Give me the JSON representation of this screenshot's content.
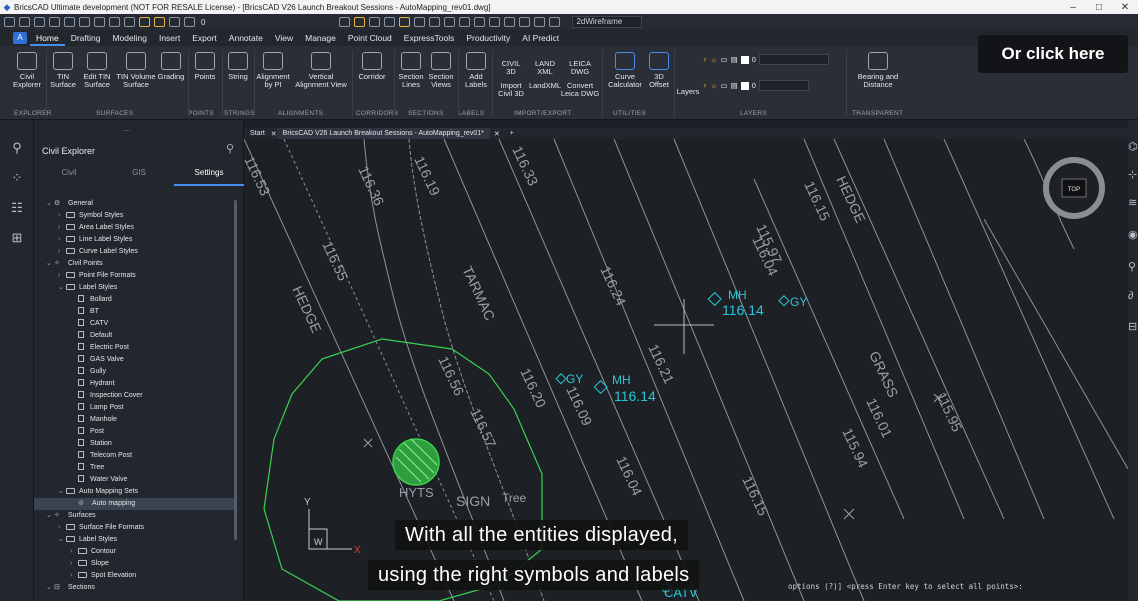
{
  "window": {
    "title": "BricsCAD Ultimate development (NOT FOR RESALE License) - [BricsCAD V26 Launch Breakout Sessions - AutoMapping_rev01.dwg]",
    "minimize": "–",
    "maximize": "□",
    "close": "✕"
  },
  "qat": {
    "layer_value": "0",
    "visual_style": "2dWireframe"
  },
  "menu": {
    "tabs": [
      "Home",
      "Drafting",
      "Modeling",
      "Insert",
      "Export",
      "Annotate",
      "View",
      "Manage",
      "Point Cloud",
      "ExpressTools",
      "Productivity",
      "AI Predict"
    ],
    "active": "Home"
  },
  "ribbon": {
    "buttons": {
      "civil_explorer": "Civil Explorer",
      "tin_surface": "TIN Surface",
      "edit_tin_surface": "Edit TIN Surface",
      "tin_volume_surface": "TIN Volume Surface",
      "grading": "Grading",
      "points": "Points",
      "string": "String",
      "alignment_by_pi": "Alignment by PI",
      "vertical_alignment_view": "Vertical Alignment View",
      "corridor": "Corridor",
      "section_lines": "Section Lines",
      "section_views": "Section Views",
      "add_labels": "Add Labels",
      "import_civil3d": "Import Civil 3D",
      "landxml": "LandXML",
      "convert_leica": "Convert Leica DWG",
      "curve_calculator": "Curve Calculator",
      "offset_3d": "3D Offset",
      "layers": "Layers",
      "bearing_distance": "Bearing and Distance"
    },
    "small_labels": {
      "civil": "CIVIL",
      "civil_3d": "3D",
      "land": "LAND",
      "xml": "XML",
      "leica": "LEICA",
      "dwg": "DWG",
      "threed": "3D"
    },
    "layer_value_1": "0",
    "layer_value_2": "0",
    "groups": [
      "EXPLORER",
      "SURFACES",
      "POINTS",
      "STRINGS",
      "ALIGNMENTS",
      "CORRIDORS",
      "SECTIONS",
      "LABELS",
      "IMPORT/EXPORT",
      "UTILITIES",
      "LAYERS",
      "TRANSPARENT"
    ]
  },
  "overlay": {
    "click_here": "Or click here"
  },
  "panel": {
    "title": "Civil Explorer",
    "dots": "....",
    "tabs": [
      "Civil",
      "GIS",
      "Settings"
    ],
    "active_tab": "Settings",
    "tree": [
      {
        "label": "General",
        "level": 0,
        "arrow": "v",
        "icon": "gear"
      },
      {
        "label": "Symbol Styles",
        "level": 1,
        "arrow": ">",
        "icon": "folder"
      },
      {
        "label": "Area Label Styles",
        "level": 1,
        "arrow": ">",
        "icon": "folder"
      },
      {
        "label": "Line Label Styles",
        "level": 1,
        "arrow": ">",
        "icon": "folder"
      },
      {
        "label": "Curve Label Styles",
        "level": 1,
        "arrow": ">",
        "icon": "folder"
      },
      {
        "label": "Civil Points",
        "level": 0,
        "arrow": "v",
        "icon": "point"
      },
      {
        "label": "Point File Formats",
        "level": 1,
        "arrow": ">",
        "icon": "folder"
      },
      {
        "label": "Label Styles",
        "level": 1,
        "arrow": "v",
        "icon": "folder"
      },
      {
        "label": "Bollard",
        "level": 2,
        "arrow": "",
        "icon": "doc"
      },
      {
        "label": "BT",
        "level": 2,
        "arrow": "",
        "icon": "doc"
      },
      {
        "label": "CATV",
        "level": 2,
        "arrow": "",
        "icon": "doc"
      },
      {
        "label": "Default",
        "level": 2,
        "arrow": "",
        "icon": "doc"
      },
      {
        "label": "Electric Post",
        "level": 2,
        "arrow": "",
        "icon": "doc"
      },
      {
        "label": "GAS Valve",
        "level": 2,
        "arrow": "",
        "icon": "doc"
      },
      {
        "label": "Gully",
        "level": 2,
        "arrow": "",
        "icon": "doc"
      },
      {
        "label": "Hydrant",
        "level": 2,
        "arrow": "",
        "icon": "doc"
      },
      {
        "label": "Inspection Cover",
        "level": 2,
        "arrow": "",
        "icon": "doc"
      },
      {
        "label": "Lamp Post",
        "level": 2,
        "arrow": "",
        "icon": "doc"
      },
      {
        "label": "Manhole",
        "level": 2,
        "arrow": "",
        "icon": "doc"
      },
      {
        "label": "Post",
        "level": 2,
        "arrow": "",
        "icon": "doc"
      },
      {
        "label": "Station",
        "level": 2,
        "arrow": "",
        "icon": "doc"
      },
      {
        "label": "Telecom Post",
        "level": 2,
        "arrow": "",
        "icon": "doc"
      },
      {
        "label": "Tree",
        "level": 2,
        "arrow": "",
        "icon": "doc"
      },
      {
        "label": "Water Valve",
        "level": 2,
        "arrow": "",
        "icon": "doc"
      },
      {
        "label": "Auto Mapping Sets",
        "level": 1,
        "arrow": "v",
        "icon": "folder"
      },
      {
        "label": "Auto mapping",
        "level": 2,
        "arrow": "",
        "icon": "check",
        "selected": true
      },
      {
        "label": "Surfaces",
        "level": 0,
        "arrow": "v",
        "icon": "point"
      },
      {
        "label": "Surface File Formats",
        "level": 1,
        "arrow": ">",
        "icon": "folder"
      },
      {
        "label": "Label Styles",
        "level": 1,
        "arrow": "v",
        "icon": "folder"
      },
      {
        "label": "Contour",
        "level": 2,
        "arrow": ">",
        "icon": "folder"
      },
      {
        "label": "Slope",
        "level": 2,
        "arrow": ">",
        "icon": "folder"
      },
      {
        "label": "Spot Elevation",
        "level": 2,
        "arrow": ">",
        "icon": "folder"
      },
      {
        "label": "Sections",
        "level": 0,
        "arrow": "v",
        "icon": "sections"
      }
    ]
  },
  "doc_tabs": {
    "start": "Start",
    "close": "✕",
    "active": "BricsCAD V26 Launch Breakout Sessions - AutoMapping_rev01*",
    "add": "+"
  },
  "viewport": {
    "viewcube": "TOP",
    "ucs_y": "Y",
    "ucs_x": "X",
    "ucs_w": "W",
    "labels": {
      "hedge_left": "HEDGE",
      "hedge_right": "HEDGE",
      "tarmac": "TARMAC",
      "grass": "GRASS",
      "sign": "SIGN",
      "tree": "Tree",
      "hyts": "HYTS",
      "catv": "CATV",
      "mh_1": "MH",
      "mh_1_elev": "116.14",
      "gy_1": "GY",
      "gy_2": "GY",
      "mh_2": "MH",
      "mh_2_elev": "116.14"
    },
    "spot_levels": [
      "116.19",
      "116.33",
      "116.36",
      "116.55",
      "116.56",
      "116.57",
      "116.24",
      "116.20",
      "116.09",
      "116.21",
      "116.04",
      "115.97",
      "116.04",
      "116.15",
      "116.01",
      "115.94",
      "115.95",
      "116.15",
      "116.53"
    ]
  },
  "captions": {
    "line1": "With all the entities displayed,",
    "line2": "using the right symbols and labels"
  },
  "command_line": "options (?)] <press Enter key to select all points>:",
  "colors": {
    "accent": "#4a8df0",
    "cyan": "#27c7d8",
    "green": "#3ad14f",
    "linework": "#9aa0a8"
  }
}
